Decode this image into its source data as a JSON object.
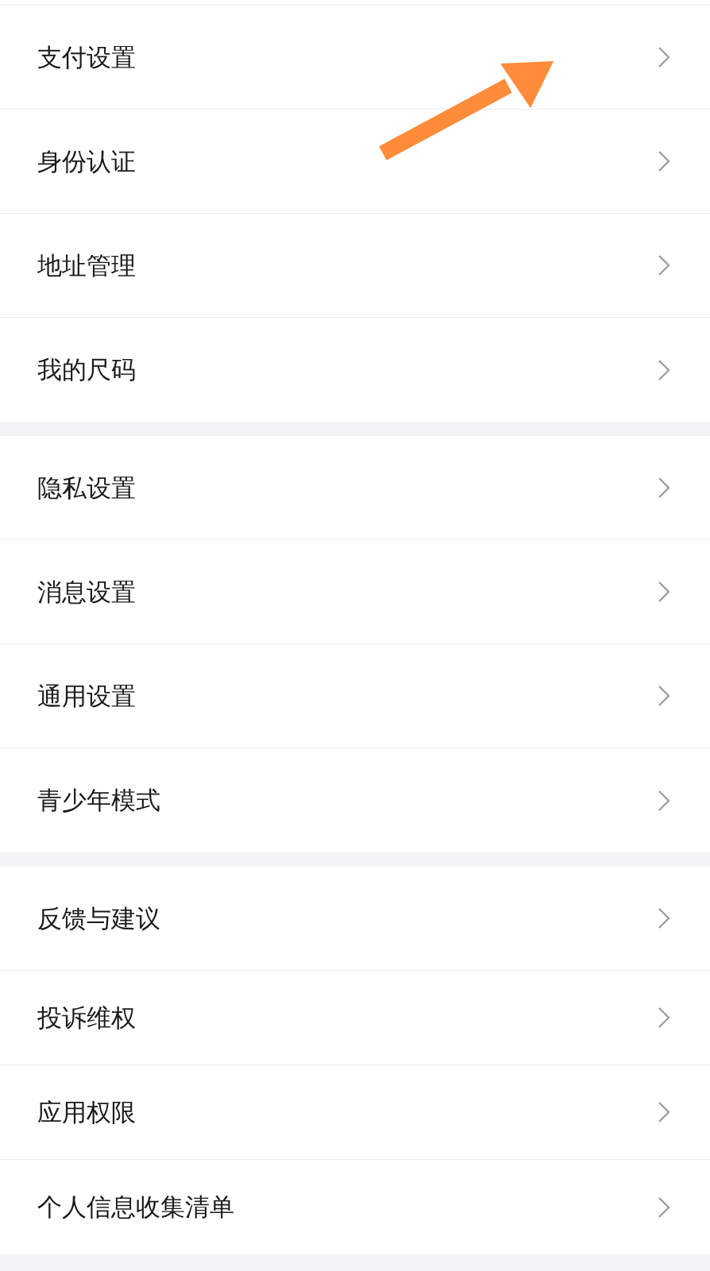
{
  "groups": [
    {
      "items": [
        {
          "label": "支付设置"
        },
        {
          "label": "身份认证"
        },
        {
          "label": "地址管理"
        },
        {
          "label": "我的尺码"
        }
      ]
    },
    {
      "items": [
        {
          "label": "隐私设置"
        },
        {
          "label": "消息设置"
        },
        {
          "label": "通用设置"
        },
        {
          "label": "青少年模式"
        }
      ]
    },
    {
      "items": [
        {
          "label": "反馈与建议"
        },
        {
          "label": "投诉维权"
        },
        {
          "label": "应用权限"
        },
        {
          "label": "个人信息收集清单"
        }
      ]
    }
  ]
}
